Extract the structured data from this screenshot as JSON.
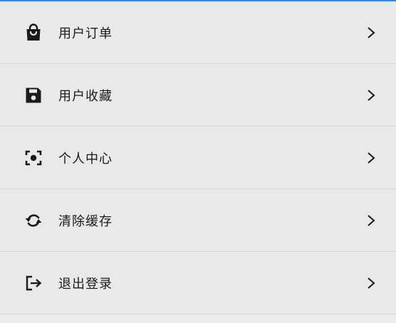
{
  "colors": {
    "accent_bar": "#2a8be0",
    "background": "#e9e9e9",
    "divider": "#d6d6d6",
    "text": "#1a1a1a",
    "icon": "#1a1a1a"
  },
  "menu": {
    "items": [
      {
        "label": "用户订单",
        "icon": "shopping-bag-icon"
      },
      {
        "label": "用户收藏",
        "icon": "floppy-disk-icon"
      },
      {
        "label": "个人中心",
        "icon": "center-focus-icon"
      },
      {
        "label": "清除缓存",
        "icon": "refresh-icon"
      },
      {
        "label": "退出登录",
        "icon": "logout-icon"
      }
    ]
  }
}
